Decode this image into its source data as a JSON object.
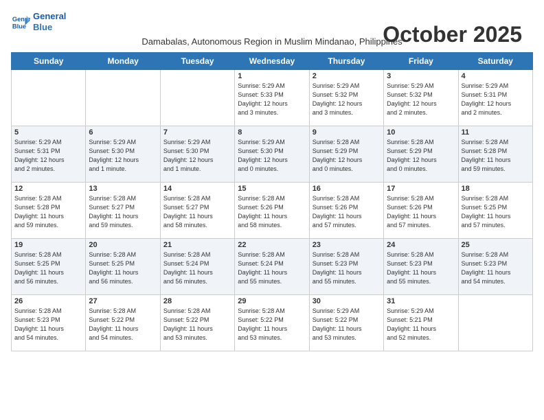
{
  "header": {
    "logo_line1": "General",
    "logo_line2": "Blue",
    "month_title": "October 2025",
    "location": "Damabalas, Autonomous Region in Muslim Mindanao, Philippines"
  },
  "weekdays": [
    "Sunday",
    "Monday",
    "Tuesday",
    "Wednesday",
    "Thursday",
    "Friday",
    "Saturday"
  ],
  "weeks": [
    [
      {
        "day": "",
        "info": ""
      },
      {
        "day": "",
        "info": ""
      },
      {
        "day": "",
        "info": ""
      },
      {
        "day": "1",
        "info": "Sunrise: 5:29 AM\nSunset: 5:33 PM\nDaylight: 12 hours\nand 3 minutes."
      },
      {
        "day": "2",
        "info": "Sunrise: 5:29 AM\nSunset: 5:32 PM\nDaylight: 12 hours\nand 3 minutes."
      },
      {
        "day": "3",
        "info": "Sunrise: 5:29 AM\nSunset: 5:32 PM\nDaylight: 12 hours\nand 2 minutes."
      },
      {
        "day": "4",
        "info": "Sunrise: 5:29 AM\nSunset: 5:31 PM\nDaylight: 12 hours\nand 2 minutes."
      }
    ],
    [
      {
        "day": "5",
        "info": "Sunrise: 5:29 AM\nSunset: 5:31 PM\nDaylight: 12 hours\nand 2 minutes."
      },
      {
        "day": "6",
        "info": "Sunrise: 5:29 AM\nSunset: 5:30 PM\nDaylight: 12 hours\nand 1 minute."
      },
      {
        "day": "7",
        "info": "Sunrise: 5:29 AM\nSunset: 5:30 PM\nDaylight: 12 hours\nand 1 minute."
      },
      {
        "day": "8",
        "info": "Sunrise: 5:29 AM\nSunset: 5:30 PM\nDaylight: 12 hours\nand 0 minutes."
      },
      {
        "day": "9",
        "info": "Sunrise: 5:28 AM\nSunset: 5:29 PM\nDaylight: 12 hours\nand 0 minutes."
      },
      {
        "day": "10",
        "info": "Sunrise: 5:28 AM\nSunset: 5:29 PM\nDaylight: 12 hours\nand 0 minutes."
      },
      {
        "day": "11",
        "info": "Sunrise: 5:28 AM\nSunset: 5:28 PM\nDaylight: 11 hours\nand 59 minutes."
      }
    ],
    [
      {
        "day": "12",
        "info": "Sunrise: 5:28 AM\nSunset: 5:28 PM\nDaylight: 11 hours\nand 59 minutes."
      },
      {
        "day": "13",
        "info": "Sunrise: 5:28 AM\nSunset: 5:27 PM\nDaylight: 11 hours\nand 59 minutes."
      },
      {
        "day": "14",
        "info": "Sunrise: 5:28 AM\nSunset: 5:27 PM\nDaylight: 11 hours\nand 58 minutes."
      },
      {
        "day": "15",
        "info": "Sunrise: 5:28 AM\nSunset: 5:26 PM\nDaylight: 11 hours\nand 58 minutes."
      },
      {
        "day": "16",
        "info": "Sunrise: 5:28 AM\nSunset: 5:26 PM\nDaylight: 11 hours\nand 57 minutes."
      },
      {
        "day": "17",
        "info": "Sunrise: 5:28 AM\nSunset: 5:26 PM\nDaylight: 11 hours\nand 57 minutes."
      },
      {
        "day": "18",
        "info": "Sunrise: 5:28 AM\nSunset: 5:25 PM\nDaylight: 11 hours\nand 57 minutes."
      }
    ],
    [
      {
        "day": "19",
        "info": "Sunrise: 5:28 AM\nSunset: 5:25 PM\nDaylight: 11 hours\nand 56 minutes."
      },
      {
        "day": "20",
        "info": "Sunrise: 5:28 AM\nSunset: 5:25 PM\nDaylight: 11 hours\nand 56 minutes."
      },
      {
        "day": "21",
        "info": "Sunrise: 5:28 AM\nSunset: 5:24 PM\nDaylight: 11 hours\nand 56 minutes."
      },
      {
        "day": "22",
        "info": "Sunrise: 5:28 AM\nSunset: 5:24 PM\nDaylight: 11 hours\nand 55 minutes."
      },
      {
        "day": "23",
        "info": "Sunrise: 5:28 AM\nSunset: 5:23 PM\nDaylight: 11 hours\nand 55 minutes."
      },
      {
        "day": "24",
        "info": "Sunrise: 5:28 AM\nSunset: 5:23 PM\nDaylight: 11 hours\nand 55 minutes."
      },
      {
        "day": "25",
        "info": "Sunrise: 5:28 AM\nSunset: 5:23 PM\nDaylight: 11 hours\nand 54 minutes."
      }
    ],
    [
      {
        "day": "26",
        "info": "Sunrise: 5:28 AM\nSunset: 5:23 PM\nDaylight: 11 hours\nand 54 minutes."
      },
      {
        "day": "27",
        "info": "Sunrise: 5:28 AM\nSunset: 5:22 PM\nDaylight: 11 hours\nand 54 minutes."
      },
      {
        "day": "28",
        "info": "Sunrise: 5:28 AM\nSunset: 5:22 PM\nDaylight: 11 hours\nand 53 minutes."
      },
      {
        "day": "29",
        "info": "Sunrise: 5:28 AM\nSunset: 5:22 PM\nDaylight: 11 hours\nand 53 minutes."
      },
      {
        "day": "30",
        "info": "Sunrise: 5:29 AM\nSunset: 5:22 PM\nDaylight: 11 hours\nand 53 minutes."
      },
      {
        "day": "31",
        "info": "Sunrise: 5:29 AM\nSunset: 5:21 PM\nDaylight: 11 hours\nand 52 minutes."
      },
      {
        "day": "",
        "info": ""
      }
    ]
  ]
}
